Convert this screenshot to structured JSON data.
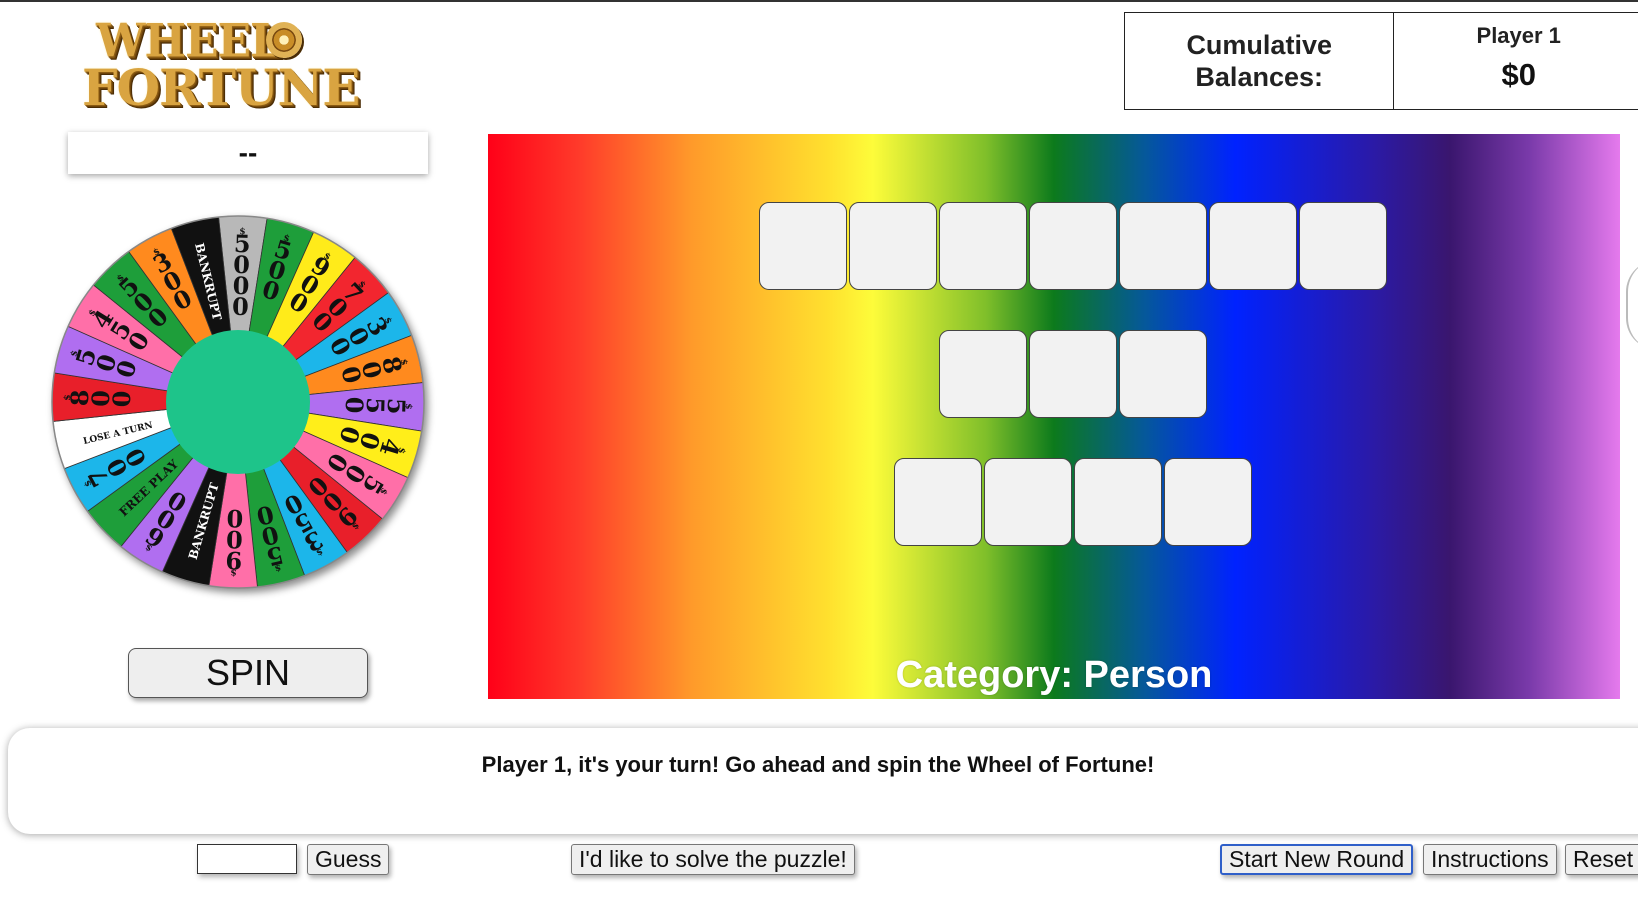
{
  "logo": {
    "line1": "WHEEL",
    "line2": "FORTUNE",
    "of": "of"
  },
  "balances": {
    "label": "Cumulative Balances:",
    "player_name": "Player 1",
    "player_balance": "$0"
  },
  "spin_result": "--",
  "spin_button": "SPIN",
  "board": {
    "rows": [
      7,
      3,
      4
    ],
    "category": "Category: Person"
  },
  "message": "Player 1, it's your turn! Go ahead and spin the Wheel of Fortune!",
  "controls": {
    "guess_value": "",
    "guess_button": "Guess",
    "solve_button": "I'd like to solve the puzzle!",
    "new_round_button": "Start New Round",
    "instructions_button": "Instructions",
    "reset_button": "Reset"
  },
  "wheel": {
    "hub_color": "#1ec48a",
    "wedges": [
      {
        "label": "5000",
        "color": "#b8b8b8"
      },
      {
        "label": "500",
        "color": "#1e9e3a"
      },
      {
        "label": "900",
        "color": "#ffeb1a"
      },
      {
        "label": "700",
        "color": "#f2262f"
      },
      {
        "label": "300",
        "color": "#1cb6ea"
      },
      {
        "label": "800",
        "color": "#ff8a1e"
      },
      {
        "label": "550",
        "color": "#b06ef0"
      },
      {
        "label": "400",
        "color": "#ffee1a"
      },
      {
        "label": "500",
        "color": "#ff6fa8"
      },
      {
        "label": "900",
        "color": "#e81f2a"
      },
      {
        "label": "350",
        "color": "#1cb6ea"
      },
      {
        "label": "500",
        "color": "#1e9e3a"
      },
      {
        "label": "900",
        "color": "#ff6fa8"
      },
      {
        "label": "BANKRUPT",
        "color": "#111111"
      },
      {
        "label": "600",
        "color": "#b06ef0"
      },
      {
        "label": "FREE PLAY",
        "color": "#1e9e3a"
      },
      {
        "label": "700",
        "color": "#1cb6ea"
      },
      {
        "label": "LOSE A TURN",
        "color": "#ffffff"
      },
      {
        "label": "800",
        "color": "#e81f2a"
      },
      {
        "label": "500",
        "color": "#b06ef0"
      },
      {
        "label": "450",
        "color": "#ff6fa8"
      },
      {
        "label": "500",
        "color": "#1e9e3a"
      },
      {
        "label": "300",
        "color": "#ff8a1e"
      },
      {
        "label": "BANKRUPT",
        "color": "#111111"
      }
    ]
  }
}
